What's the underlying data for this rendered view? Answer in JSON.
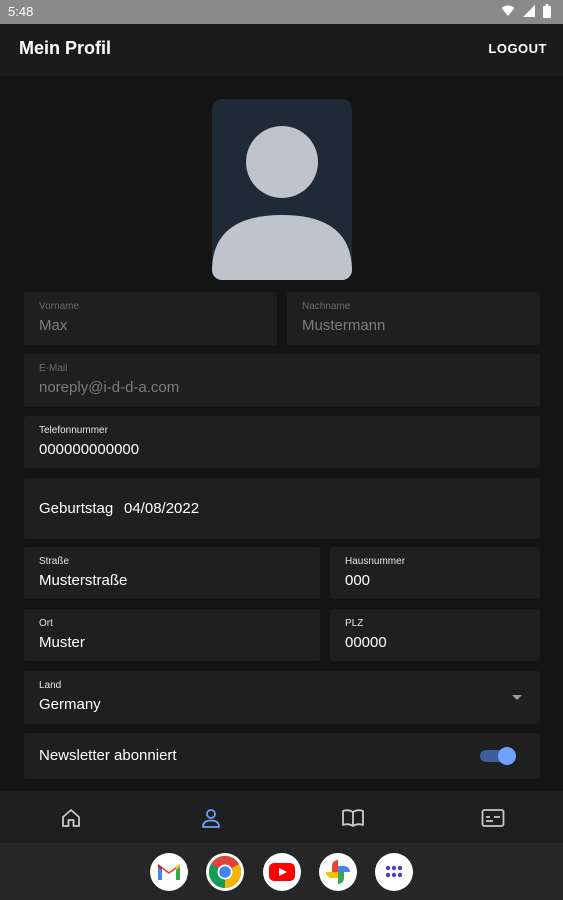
{
  "status_bar": {
    "time": "5:48"
  },
  "app_bar": {
    "title": "Mein Profil",
    "logout": "LOGOUT"
  },
  "form": {
    "vorname": {
      "label": "Vorname",
      "value": "Max"
    },
    "nachname": {
      "label": "Nachname",
      "value": "Mustermann"
    },
    "email": {
      "label": "E-Mail",
      "value": "noreply@i-d-d-a.com"
    },
    "telefon": {
      "label": "Telefonnummer",
      "value": "000000000000"
    },
    "geburtstag": {
      "label": "Geburtstag",
      "value": "04/08/2022"
    },
    "strasse": {
      "label": "Straße",
      "value": "Musterstraße"
    },
    "hausnummer": {
      "label": "Hausnummer",
      "value": "000"
    },
    "ort": {
      "label": "Ort",
      "value": "Muster"
    },
    "plz": {
      "label": "PLZ",
      "value": "00000"
    },
    "land": {
      "label": "Land",
      "value": "Germany"
    },
    "newsletter": {
      "label": "Newsletter abonniert",
      "enabled": true
    }
  },
  "bottom_nav": [
    "home-icon",
    "profile-icon",
    "book-icon",
    "terminal-card-icon"
  ],
  "dock_apps": [
    "gmail-icon",
    "chrome-icon",
    "youtube-icon",
    "photos-icon",
    "app-drawer-icon"
  ],
  "colors": {
    "accent": "#6ea0ff",
    "background": "#141414",
    "field": "#1f1f1f"
  }
}
